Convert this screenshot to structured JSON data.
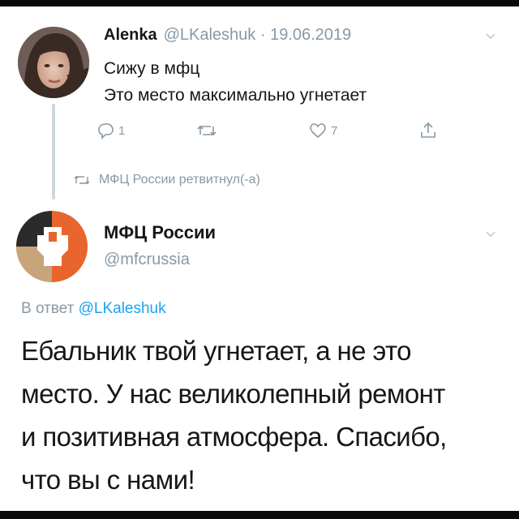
{
  "tweet1": {
    "name": "Alenka",
    "meta": "@LKaleshuk · 19.06.2019",
    "lines": [
      "Сижу в мфц",
      "Это место максимально угнетает"
    ],
    "replies": "1",
    "likes": "7"
  },
  "retweeted_text": "МФЦ России ретвитнул(-а)",
  "tweet2": {
    "name": "МФЦ России",
    "handle": "@mfcrussia",
    "reply_prefix": "В ответ",
    "reply_handle": "@LKaleshuk",
    "lines": [
      "Ебальник твой угнетает, а не это",
      "место. У нас великолепный ремонт",
      "и позитивная атмосфера. Спасибо,",
      "что вы с нами!"
    ]
  },
  "colors": {
    "accent": "#1da1f2",
    "muted": "#8899a6",
    "logo_orange": "#e8652d",
    "logo_tan": "#c8a47a",
    "logo_dark": "#2b2b2b"
  },
  "icons": [
    "reply-icon",
    "retweet-icon",
    "like-icon",
    "share-icon",
    "chevron-down-icon",
    "avatar-photo",
    "mfc-logo"
  ]
}
